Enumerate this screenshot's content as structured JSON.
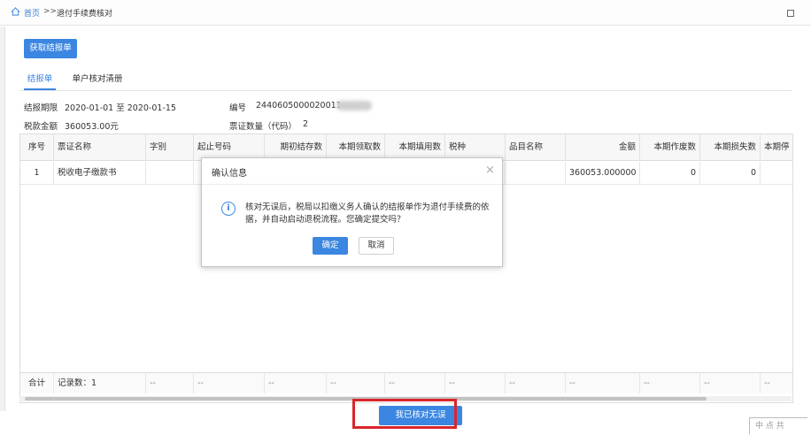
{
  "breadcrumb": {
    "home": "首页",
    "sep": ">>",
    "page": "退付手续费核对"
  },
  "toolbar": {
    "get_button": "获取结报单"
  },
  "tabs": [
    {
      "label": "结报单"
    },
    {
      "label": "单户核对清册"
    }
  ],
  "info": {
    "period_label": "结报期限",
    "period_value": "2020-01-01 至 2020-01-15",
    "number_label": "编号",
    "number_value": "2440605000020011",
    "tax_label": "税款金额",
    "tax_value": "360053.00元",
    "count_label": "票证数量（代码）",
    "count_value": "2"
  },
  "table": {
    "headers": [
      "序号",
      "票证名称",
      "字别",
      "起止号码",
      "期初结存数",
      "本期领取数",
      "本期填用数",
      "税种",
      "品目名称",
      "金额",
      "本期作废数",
      "本期损失数",
      "本期停"
    ],
    "rows": [
      [
        "1",
        "税收电子缴款书",
        "",
        "",
        "",
        "",
        "",
        "",
        "",
        "360053.000000",
        "0",
        "0",
        ""
      ]
    ],
    "footer": {
      "total_label": "合计",
      "record_count": "记录数：1",
      "dash": "--"
    }
  },
  "actions": {
    "confirm_button": "我已核对无误"
  },
  "dialog": {
    "title": "确认信息",
    "close": "×",
    "message_line1": "核对无误后，税局以扣缴义务人确认的结报单作为退付手续费的依",
    "message_line2": "据，并自动启动退税流程。您确定提交吗？",
    "ok": "确定",
    "cancel": "取消"
  },
  "watermark": "中 点 共"
}
